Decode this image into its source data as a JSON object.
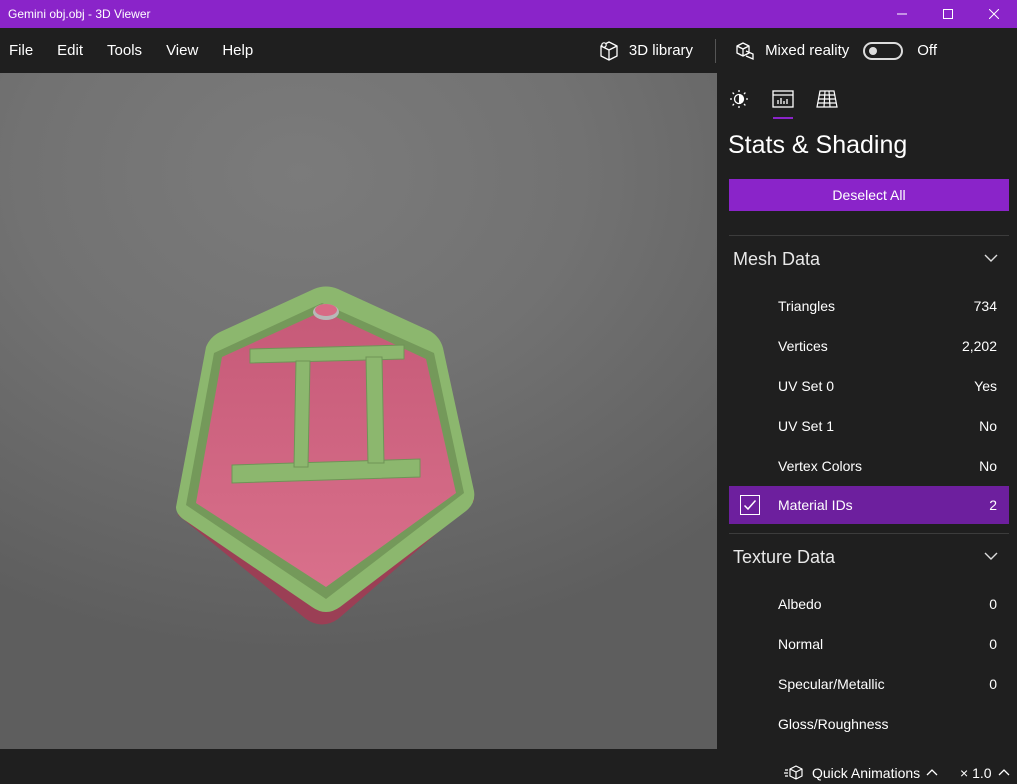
{
  "window": {
    "title": "Gemini obj.obj - 3D Viewer"
  },
  "menu": {
    "items": [
      "File",
      "Edit",
      "Tools",
      "View",
      "Help"
    ]
  },
  "commands": {
    "library_label": "3D library",
    "mixed_reality_label": "Mixed reality",
    "toggle_state": "Off"
  },
  "panel": {
    "tabs": [
      "lighting-icon",
      "stats-icon",
      "grid-icon"
    ],
    "active_tab": 1,
    "title": "Stats & Shading",
    "deselect_label": "Deselect All",
    "mesh": {
      "heading": "Mesh Data",
      "rows": [
        {
          "label": "Triangles",
          "value": "734"
        },
        {
          "label": "Vertices",
          "value": "2,202"
        },
        {
          "label": "UV Set 0",
          "value": "Yes"
        },
        {
          "label": "UV Set 1",
          "value": "No"
        },
        {
          "label": "Vertex Colors",
          "value": "No"
        },
        {
          "label": "Material IDs",
          "value": "2",
          "selected": true
        }
      ]
    },
    "texture": {
      "heading": "Texture Data",
      "rows": [
        {
          "label": "Albedo",
          "value": "0"
        },
        {
          "label": "Normal",
          "value": "0"
        },
        {
          "label": "Specular/Metallic",
          "value": "0"
        },
        {
          "label": "Gloss/Roughness",
          "value": ""
        }
      ]
    }
  },
  "status": {
    "quick_animations_label": "Quick Animations",
    "speed": "× 1.0"
  },
  "colors": {
    "accent": "#8a24c9",
    "selected_row": "#6d1f9e",
    "model_face": "#d86a85",
    "model_rim": "#8cb76e"
  }
}
